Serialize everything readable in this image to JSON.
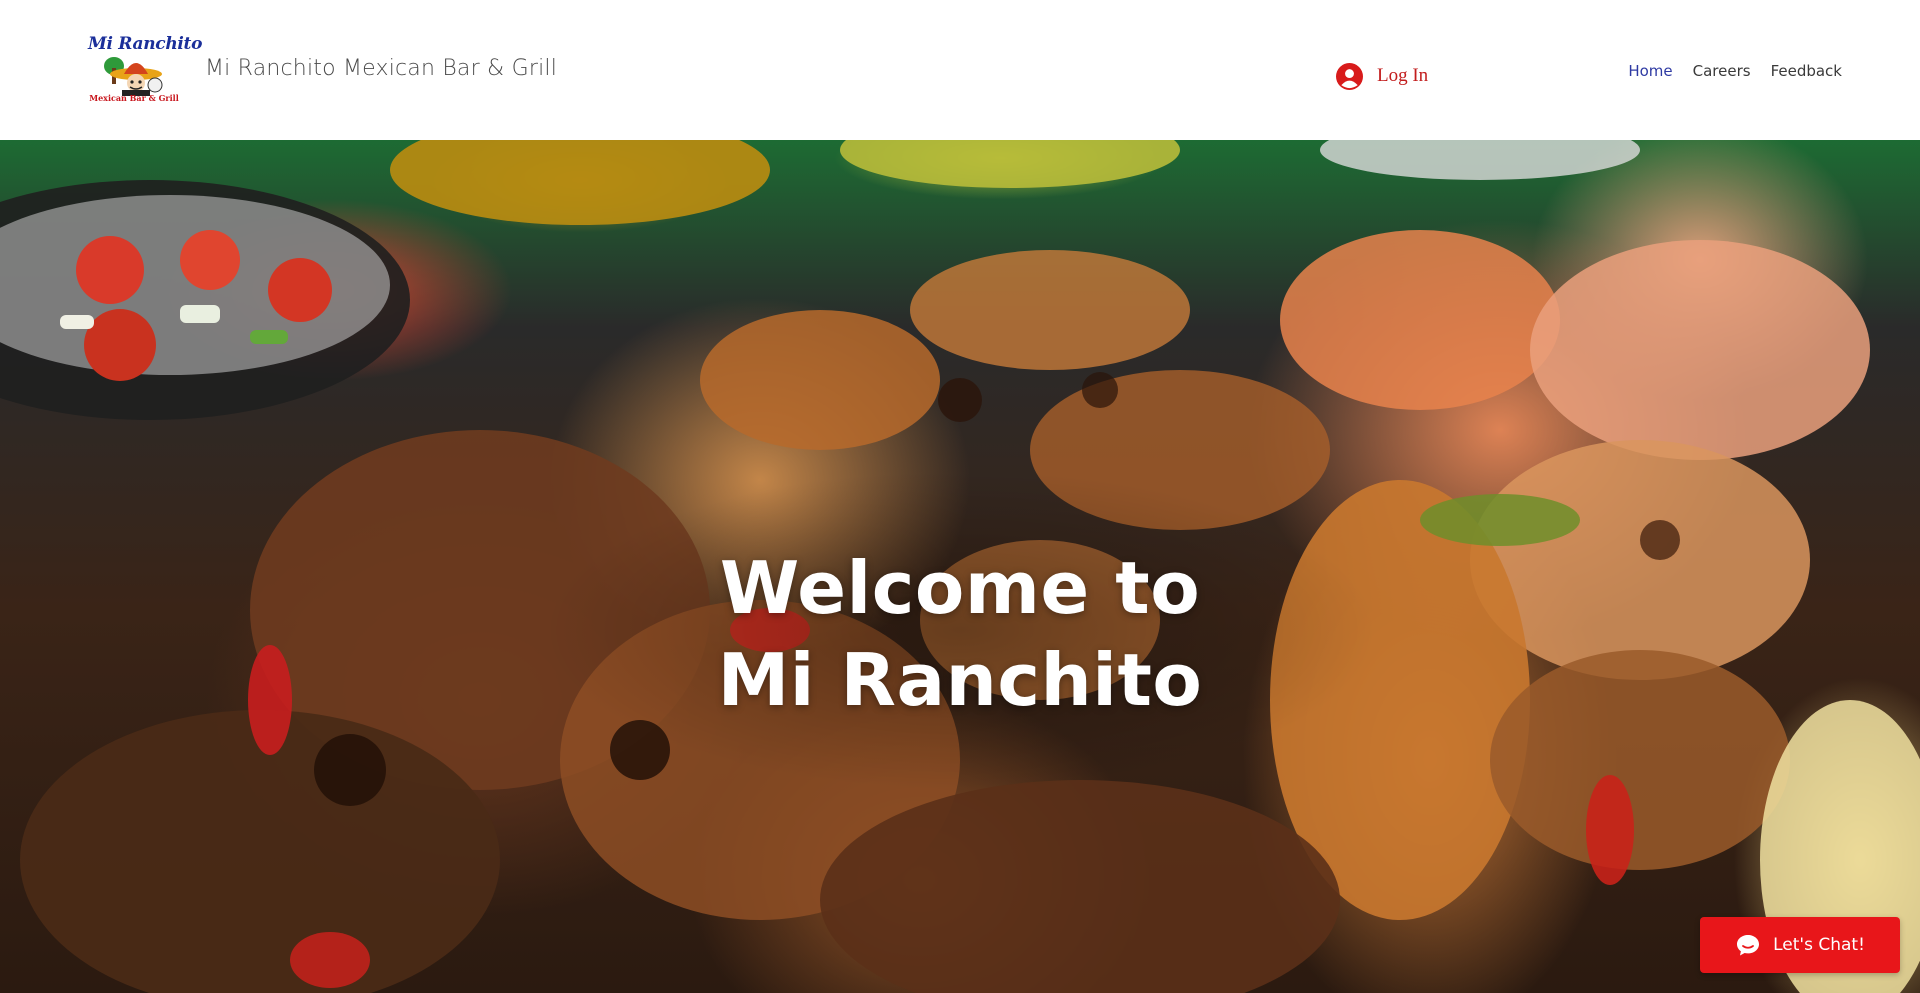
{
  "header": {
    "logo": {
      "script_text": "Mi Ranchito",
      "subtitle": "Mexican Bar & Grill"
    },
    "site_title": "Mi Ranchito Mexican Bar & Grill",
    "login": {
      "label": "Log In",
      "icon": "user-avatar-icon"
    },
    "nav": [
      {
        "label": "Home",
        "active": true
      },
      {
        "label": "Careers",
        "active": false
      },
      {
        "label": "Feedback",
        "active": false
      }
    ]
  },
  "hero": {
    "title_line1": "Welcome to",
    "title_line2": "Mi Ranchito",
    "background": "fajita-platter-photo"
  },
  "chat_widget": {
    "label": "Let's Chat!",
    "icon": "chat-bubble-icon"
  },
  "colors": {
    "nav_active": "#2e3aa3",
    "login_accent": "#c21d1d",
    "chat_button": "#e8161a"
  }
}
